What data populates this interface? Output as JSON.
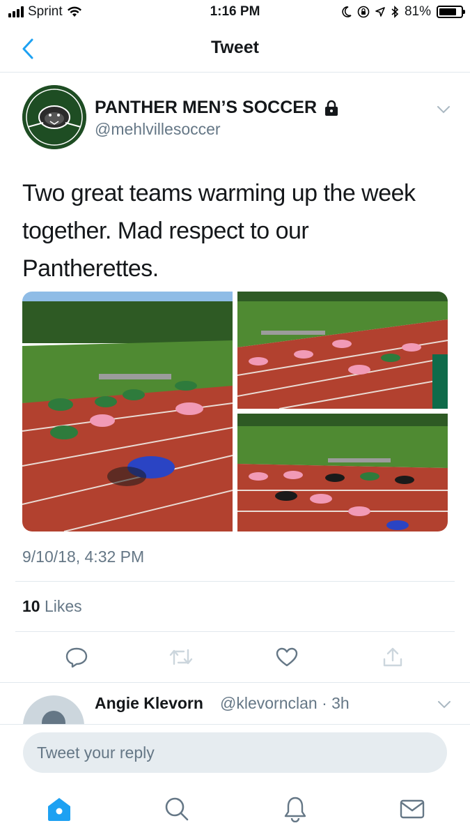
{
  "status_bar": {
    "carrier": "Sprint",
    "time": "1:16 PM",
    "battery_percent": "81%",
    "battery_level": 0.81
  },
  "nav": {
    "title": "Tweet",
    "back_icon": "chevron-left-icon"
  },
  "tweet": {
    "display_name": "PANTHER MEN’S SOCCER",
    "protected_icon": "lock-icon",
    "handle": "@mehlvillesoccer",
    "avatar_text_top": "MEHLVILLE",
    "avatar_text_bottom": "SOCCER",
    "text_lines": [
      "Two great teams warming up the week",
      "together. Mad respect to our",
      "Pantherettes."
    ],
    "timestamp": "9/10/18, 4:32 PM",
    "likes_count": "10",
    "likes_label": "Likes"
  },
  "actions": [
    {
      "name": "reply-icon"
    },
    {
      "name": "retweet-icon"
    },
    {
      "name": "like-icon"
    },
    {
      "name": "share-icon"
    }
  ],
  "reply": {
    "name": "Angie Klevorn",
    "handle": "@klevornclan",
    "age": "· 3h"
  },
  "composer": {
    "placeholder": "Tweet your reply"
  },
  "tabbar": [
    {
      "name": "home-icon",
      "active": true
    },
    {
      "name": "search-icon",
      "active": false
    },
    {
      "name": "notifications-icon",
      "active": false
    },
    {
      "name": "messages-icon",
      "active": false
    }
  ],
  "colors": {
    "accent": "#1da1f2",
    "muted": "#657786",
    "text": "#14171a",
    "divider": "#e1e8ed",
    "track": "#b2412f",
    "grass": "#4f8a32"
  }
}
